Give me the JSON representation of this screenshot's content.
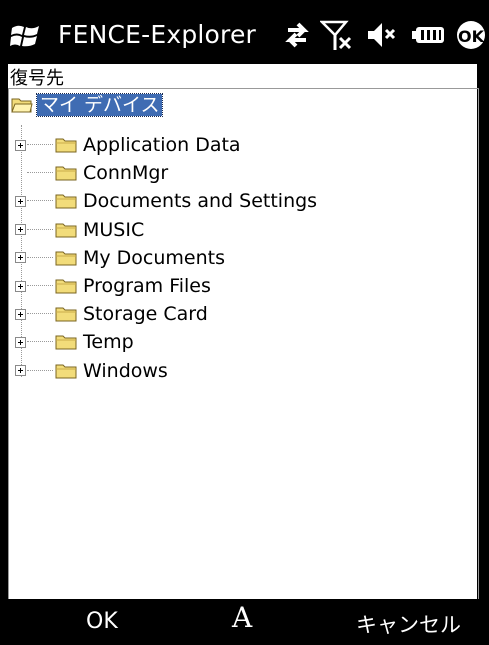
{
  "titlebar": {
    "app_title": "FENCE-Explorer",
    "icons": [
      "windows-start-icon",
      "data-sync-icon",
      "signal-off-icon",
      "volume-mute-icon",
      "battery-icon",
      "ok-icon"
    ],
    "ok_label": "OK"
  },
  "content": {
    "label": "復号先",
    "root": {
      "label": "マイ デバイス",
      "selected": true
    },
    "nodes": [
      {
        "label": "Application Data",
        "expandable": true
      },
      {
        "label": "ConnMgr",
        "expandable": false
      },
      {
        "label": "Documents and Settings",
        "expandable": true
      },
      {
        "label": "MUSIC",
        "expandable": true
      },
      {
        "label": "My Documents",
        "expandable": true
      },
      {
        "label": "Program Files",
        "expandable": true
      },
      {
        "label": "Storage Card",
        "expandable": true
      },
      {
        "label": "Temp",
        "expandable": true
      },
      {
        "label": "Windows",
        "expandable": true
      }
    ]
  },
  "softkeys": {
    "left": "OK",
    "center": "A",
    "right": "キャンセル"
  },
  "colors": {
    "selection": "#3f6cb3",
    "folder": "#f2dc7a"
  }
}
